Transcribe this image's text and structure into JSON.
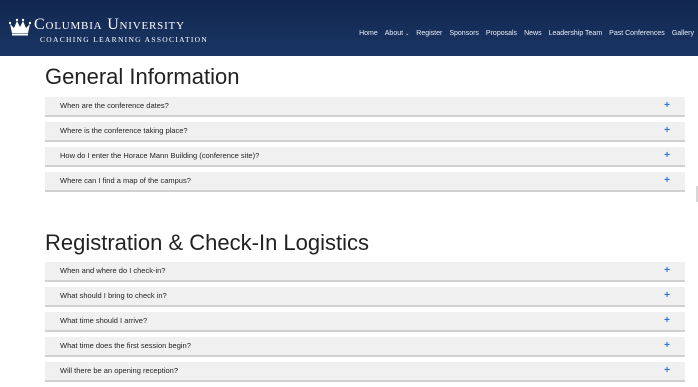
{
  "header": {
    "logo_title": "Columbia University",
    "logo_subtitle": "COACHING LEARNING ASSOCIATION",
    "nav": [
      "Home",
      "About",
      "Register",
      "Sponsors",
      "Proposals",
      "News",
      "Leadership Team",
      "Past Conferences",
      "Gallery"
    ],
    "brand_color": "#112750",
    "accent_color": "#2b74d9"
  },
  "sections": [
    {
      "title": "General Information",
      "questions": [
        "When are the conference dates?",
        "Where is the conference taking place?",
        "How do I enter the Horace Mann Building (conference site)?",
        "Where can I find a map of the campus?"
      ]
    },
    {
      "title": "Registration & Check-In Logistics",
      "questions": [
        "When and where do I check-in?",
        "What should I bring to check in?",
        "What time should I arrive?",
        "What time does the first session begin?",
        "Will there be an opening reception?"
      ]
    }
  ],
  "expand_icon": "+"
}
